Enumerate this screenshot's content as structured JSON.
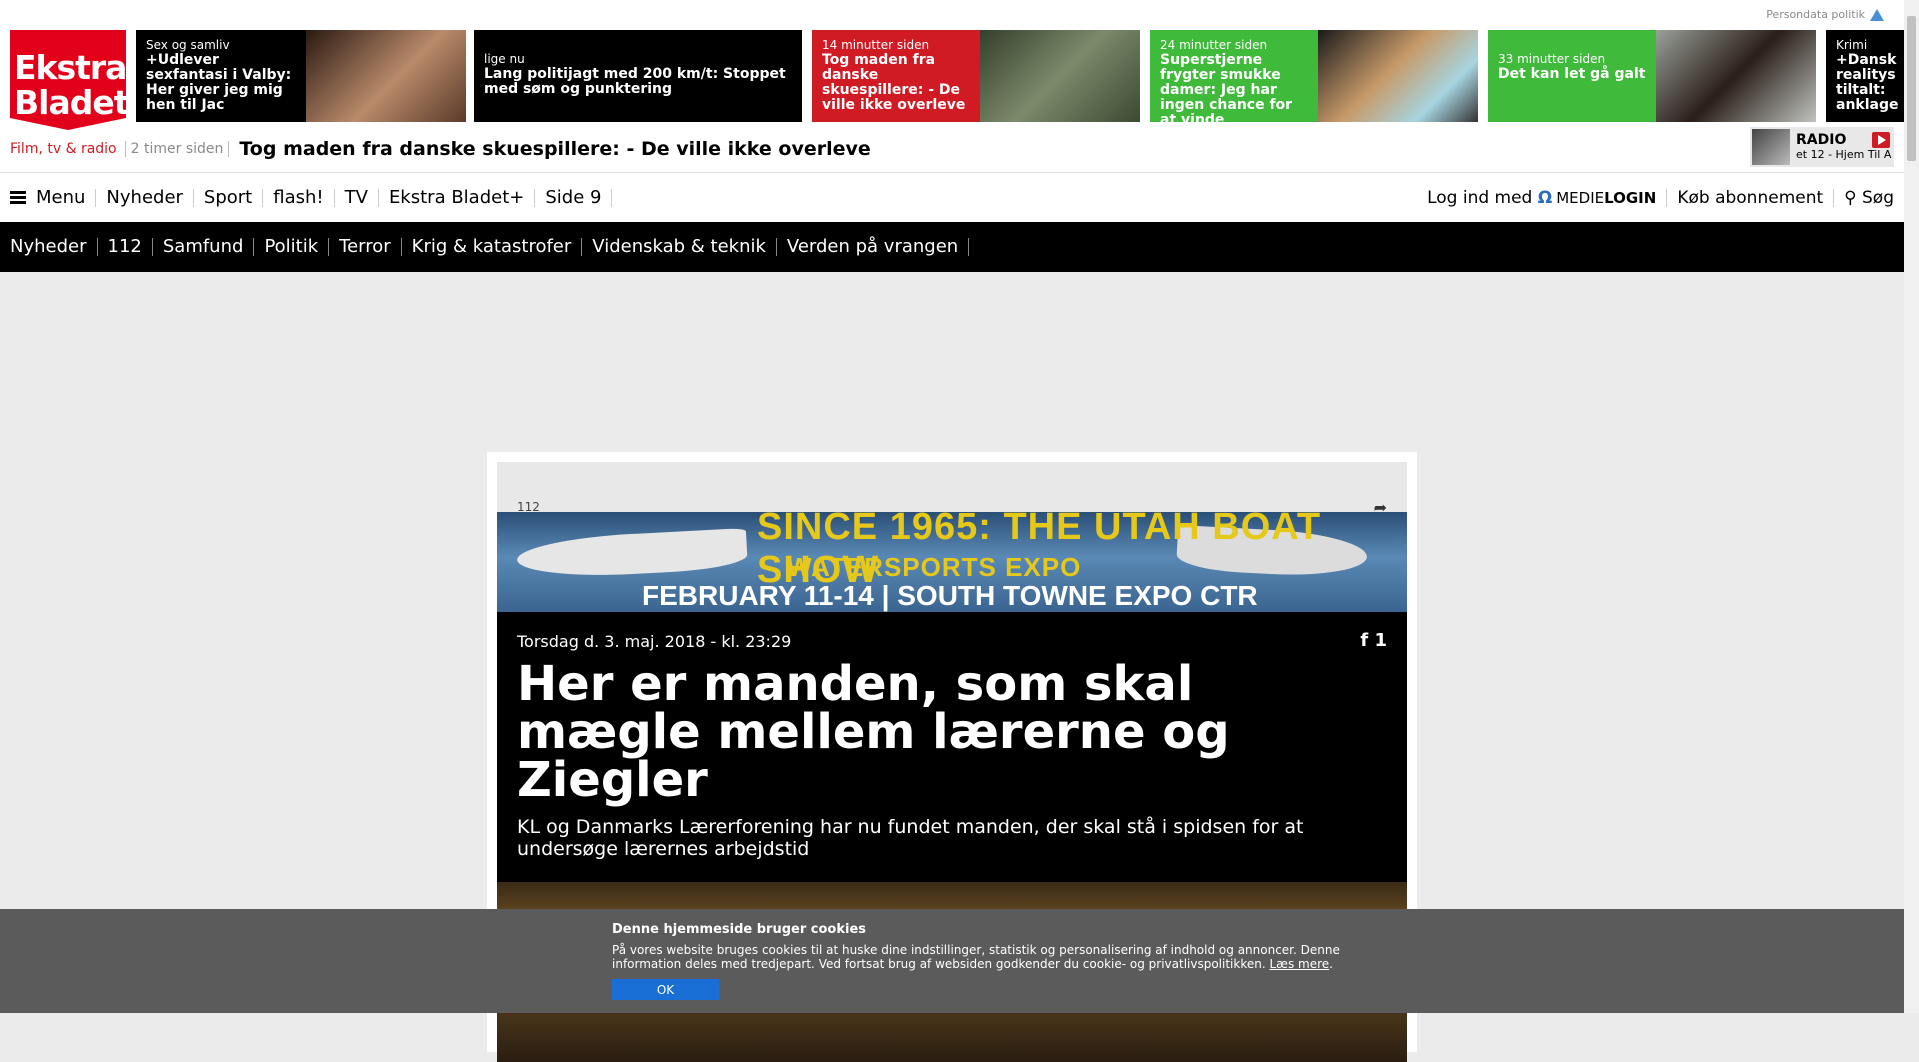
{
  "topbar": {
    "persondata": "Persondata politik",
    "logo_line1": "Ekstra",
    "logo_line2": "Bladet",
    "teasers": [
      {
        "section": "Sex og samliv",
        "headline": "+Udlever sexfantasi i Valby: Her giver jeg mig hen til Jac",
        "style": "black"
      },
      {
        "section": "lige nu",
        "headline": "Lang politijagt med 200 km/t: Stoppet med søm og punktering",
        "style": "black"
      },
      {
        "section": "14 minutter siden",
        "headline": "Tog maden fra danske skuespillere: - De ville ikke overleve",
        "style": "red"
      },
      {
        "section": "24 minutter siden",
        "headline": "Superstjerne frygter smukke damer: Jeg har ingen chance for at vinde",
        "style": "green"
      },
      {
        "section": "33 minutter siden",
        "headline": "Det kan let gå galt",
        "style": "green"
      },
      {
        "section": "Krimi",
        "headline": "+Dansk realitys tiltalt: anklage",
        "style": "black"
      }
    ],
    "ticker": {
      "category": "Film, tv & radio",
      "time": "2 timer siden",
      "headline": "Tog maden fra danske skuespillere: - De ville ikke overleve"
    },
    "radio": {
      "title": "RADIO",
      "subtitle": "et 12 - Hjem Til A"
    }
  },
  "mainnav": {
    "menu_label": "Menu",
    "items": [
      "Nyheder",
      "Sport",
      "flash!",
      "TV",
      "Ekstra Bladet+",
      "Side 9"
    ],
    "login_label": "Log ind med",
    "medielogin_prefix": "MEDIE",
    "medielogin_suffix": "LOGIN",
    "subscribe_label": "Køb abonnement",
    "search_label": "Søg"
  },
  "subnav": {
    "items": [
      "Nyheder",
      "112",
      "Samfund",
      "Politik",
      "Terror",
      "Krig & katastrofer",
      "Videnskab & teknik",
      "Verden på vrangen"
    ]
  },
  "article": {
    "category": "112",
    "banner": {
      "line1": "SINCE 1965: THE UTAH BOAT SHOW",
      "line2": "WATERSPORTS EXPO",
      "line3": "FEBRUARY 11-14  |  SOUTH TOWNE EXPO CTR"
    },
    "dateline": "Torsdag d. 3. maj. 2018 - kl. 23:29",
    "fb_count": "1",
    "headline": "Her er manden, som skal mægle mellem lærerne og Ziegler",
    "lede": "KL og Danmarks Lærerforening har nu fundet manden, der skal stå i spidsen for at undersøge lærernes arbejdstid"
  },
  "cookie": {
    "title": "Denne hjemmeside bruger cookies",
    "body": "På vores website bruges cookies til at huske dine indstillinger, statistik og personalisering af indhold og annoncer. Denne information deles med tredjepart. Ved fortsat brug af websiden godkender du cookie- og privatlivspolitikken.",
    "read_more": "Læs mere",
    "ok_label": "OK"
  },
  "colors": {
    "brand_red": "#e2001a",
    "teaser_red": "#d11b24",
    "teaser_green": "#3fba3a",
    "cookie_button": "#1a6fd6"
  }
}
